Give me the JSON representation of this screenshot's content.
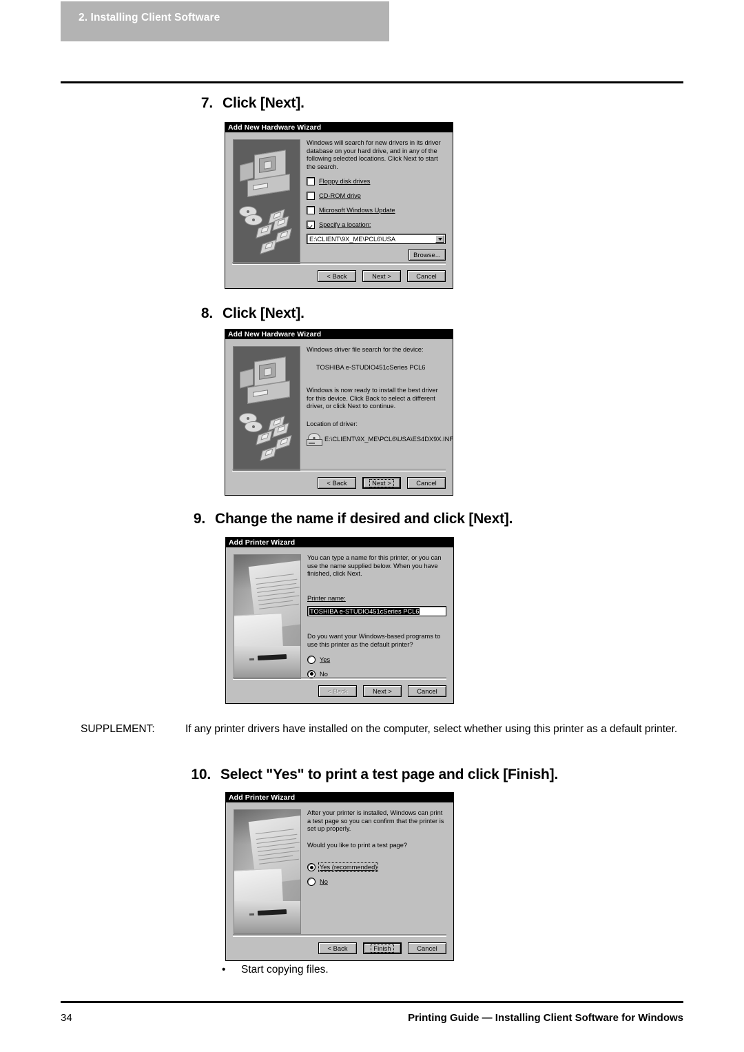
{
  "page": {
    "header_tab": "2. Installing Client Software",
    "footer_page_number": "34",
    "footer_text": "Printing Guide — Installing Client Software for Windows"
  },
  "steps": [
    {
      "number": "7.",
      "text": "Click [Next]."
    },
    {
      "number": "8.",
      "text": "Click [Next]."
    },
    {
      "number": "9.",
      "text": "Change the name if desired and click [Next]."
    },
    {
      "number": "10.",
      "text": "Select \"Yes\" to print a test page and click [Finish]."
    }
  ],
  "supplement": {
    "label": "SUPPLEMENT:",
    "text": "If any printer drivers have installed on the computer, select whether using this printer as a default printer."
  },
  "bullet": {
    "marker": "•",
    "text": "Start copying files."
  },
  "dialog_hw_search": {
    "title": "Add New Hardware Wizard",
    "body": "Windows will search for new drivers in its driver database on your hard drive, and in any of the following selected locations. Click Next to start the search.",
    "checkboxes": [
      {
        "label": "Floppy disk drives",
        "checked": false
      },
      {
        "label": "CD-ROM drive",
        "checked": false
      },
      {
        "label": "Microsoft Windows Update",
        "checked": false
      },
      {
        "label": "Specify a location:",
        "checked": true
      }
    ],
    "location_value": "E:\\CLIENT\\9X_ME\\PCL6\\USA",
    "browse_label": "Browse...",
    "buttons": [
      {
        "label": "< Back",
        "state": "enabled"
      },
      {
        "label": "Next >",
        "state": "enabled"
      },
      {
        "label": "Cancel",
        "state": "enabled"
      }
    ]
  },
  "dialog_hw_ready": {
    "title": "Add New Hardware Wizard",
    "line1": "Windows driver file search for the device:",
    "device_name": "TOSHIBA e-STUDIO451cSeries PCL6",
    "line2": "Windows is now ready to install the best driver for this device. Click Back to select a different driver, or click Next to continue.",
    "location_label": "Location of driver:",
    "driver_path": "E:\\CLIENT\\9X_ME\\PCL6\\USA\\ES4DX9X.INF",
    "buttons": [
      {
        "label": "< Back",
        "state": "enabled"
      },
      {
        "label": "Next >",
        "state": "default"
      },
      {
        "label": "Cancel",
        "state": "enabled"
      }
    ]
  },
  "dialog_printer_name": {
    "title": "Add Printer Wizard",
    "body": "You can type a name for this printer, or you can use the name supplied below. When you have finished, click Next.",
    "field_label": "Printer name:",
    "printer_name": "TOSHIBA e-STUDIO451cSeries PCL6",
    "question": "Do you want your Windows-based programs to use this printer as the default printer?",
    "options": [
      {
        "label": "Yes",
        "selected": false
      },
      {
        "label": "No",
        "selected": true
      }
    ],
    "buttons": [
      {
        "label": "< Back",
        "state": "disabled"
      },
      {
        "label": "Next >",
        "state": "enabled"
      },
      {
        "label": "Cancel",
        "state": "enabled"
      }
    ]
  },
  "dialog_test_page": {
    "title": "Add Printer Wizard",
    "body": "After your printer is installed, Windows can print a test page so you can confirm that the printer is set up properly.",
    "question": "Would you like to print a test page?",
    "options": [
      {
        "label": "Yes (recommended)",
        "selected": true
      },
      {
        "label": "No",
        "selected": false
      }
    ],
    "buttons": [
      {
        "label": "< Back",
        "state": "enabled"
      },
      {
        "label": "Finish",
        "state": "default"
      },
      {
        "label": "Cancel",
        "state": "enabled"
      }
    ]
  }
}
